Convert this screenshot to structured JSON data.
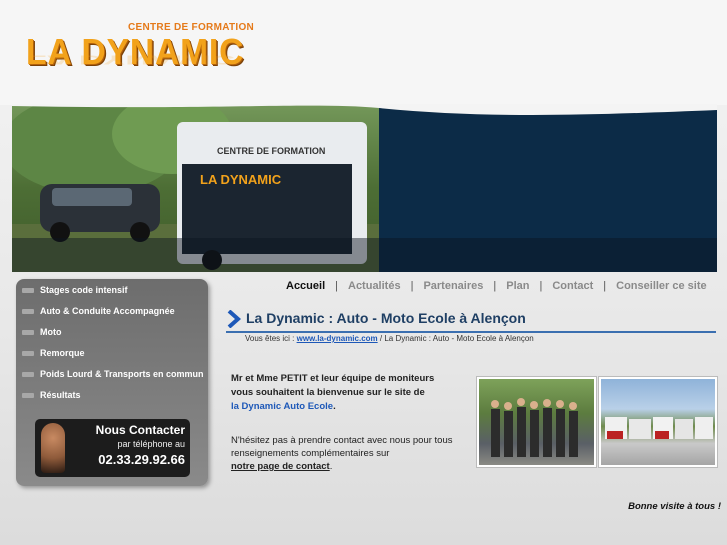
{
  "logo": {
    "subtitle": "CENTRE DE FORMATION",
    "name": "LA DYNAMIC"
  },
  "nav": {
    "items": [
      {
        "label": "Accueil",
        "active": true
      },
      {
        "label": "Actualités"
      },
      {
        "label": "Partenaires"
      },
      {
        "label": "Plan"
      },
      {
        "label": "Contact"
      },
      {
        "label": "Conseiller ce site"
      }
    ],
    "separator": "|"
  },
  "sidebar": {
    "items": [
      {
        "label": "Stages code intensif"
      },
      {
        "label": "Auto & Conduite Accompagnée"
      },
      {
        "label": "Moto"
      },
      {
        "label": "Remorque"
      },
      {
        "label": "Poids Lourd & Transports en commun"
      },
      {
        "label": "Résultats"
      }
    ],
    "contact": {
      "title": "Nous Contacter",
      "subtitle": "par téléphone au",
      "phone": "02.33.29.92.66"
    }
  },
  "main": {
    "title": "La Dynamic : Auto - Moto Ecole à Alençon",
    "breadcrumb": {
      "prefix": "Vous êtes ici :",
      "link": "www.la-dynamic.com",
      "rest": "/ La Dynamic : Auto - Moto Ecole à Alençon"
    },
    "intro_line1": "Mr et Mme PETIT et leur équipe de moniteurs",
    "intro_line2": "vous souhaitent la bienvenue sur le site de",
    "intro_link": "la Dynamic Auto Ecole",
    "intro_end": ".",
    "contact_text": "N'hésitez pas à prendre contact avec nous pour tous renseignements complémentaires sur",
    "contact_link": "notre page de contact",
    "contact_end": ".",
    "goodbye": "Bonne visite à tous !"
  },
  "hero": {
    "trailer_text1": "CENTRE DE FORMATION",
    "trailer_text2": "LA DYNAMIC"
  },
  "colors": {
    "accent": "#1d58b8",
    "logo": "#f2a21b",
    "hero_dark": "#0c2b47"
  }
}
